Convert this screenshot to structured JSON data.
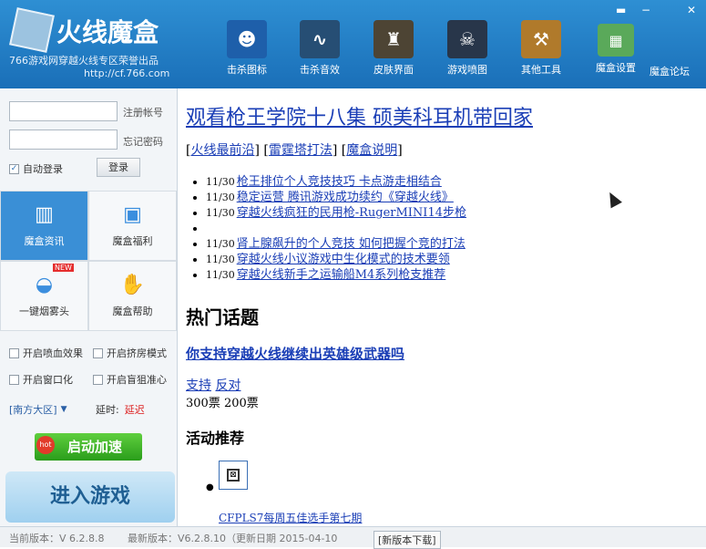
{
  "app": {
    "title": "火线魔盒",
    "subtitle": "766游戏网穿越火线专区荣誉出品",
    "url": "http://cf.766.com"
  },
  "toolbar": [
    {
      "label": "击杀图标",
      "icon": "kill-icon",
      "color": "#1e5faa"
    },
    {
      "label": "击杀音效",
      "icon": "sound-wave-icon",
      "color": "#264e74"
    },
    {
      "label": "皮肤界面",
      "icon": "skin-icon",
      "color": "#4d4434"
    },
    {
      "label": "游戏喷图",
      "icon": "spray-icon",
      "color": "#28364a"
    },
    {
      "label": "其他工具",
      "icon": "tools-icon",
      "color": "#b07a2b"
    }
  ],
  "header_links": {
    "settings": "魔盒设置",
    "forum": "魔盒论坛"
  },
  "window_controls": {
    "menu": "▬",
    "min": "−",
    "close": "✕"
  },
  "login": {
    "account_placeholder": "",
    "password_placeholder": "",
    "register_label": "注册帐号",
    "forgot_label": "忘记密码",
    "auto_login_label": "自动登录",
    "auto_login_checked": true,
    "login_button": "登录"
  },
  "nav_tiles": [
    {
      "label": "魔盒资讯",
      "icon": "book-icon",
      "active": true
    },
    {
      "label": "魔盒福利",
      "icon": "gift-icon",
      "active": false
    },
    {
      "label": "一键烟雾头",
      "icon": "helmet-icon",
      "active": false,
      "badge": "NEW"
    },
    {
      "label": "魔盒帮助",
      "icon": "hand-icon",
      "active": false
    }
  ],
  "options": [
    {
      "label": "开启喷血效果",
      "checked": false
    },
    {
      "label": "开启挤房模式",
      "checked": false
    },
    {
      "label": "开启窗口化",
      "checked": false
    },
    {
      "label": "开启盲狙准心",
      "checked": false
    }
  ],
  "server": {
    "region": "[南方大区]",
    "latency_label": "延时:",
    "latency_value": "延迟"
  },
  "accelerate_button": "启动加速",
  "hot_badge": "hot",
  "enter_game_button": "进入游戏",
  "content": {
    "headline": "观看枪王学院十八集 硕美科耳机带回家",
    "tabs": [
      "火线最前沿",
      "雷霆塔打法",
      "魔盒说明"
    ],
    "news": [
      {
        "date": "11/30",
        "title": "枪王排位个人竞技技巧 卡点游走相结合"
      },
      {
        "date": "11/30",
        "title": "稳定运营 腾讯游戏成功续约《穿越火线》"
      },
      {
        "date": "11/30",
        "title": "穿越火线疯狂的民用枪-RugerMINI14步枪"
      },
      {
        "date": "",
        "title": ""
      },
      {
        "date": "11/30",
        "title": "肾上腺飙升的个人竞技 如何把握个竞的打法"
      },
      {
        "date": "11/30",
        "title": "穿越火线小议游戏中生化模式的技术要领"
      },
      {
        "date": "11/30",
        "title": "穿越火线新手之运输船M4系列枪支推荐"
      }
    ],
    "hot_topics_title": "热门话题",
    "poll_question": "你支持穿越火线继续出英雄级武器吗",
    "poll_support": "支持",
    "poll_oppose": "反对",
    "poll_counts": "300票 200票",
    "activity_title": "活动推荐",
    "activity_item": "CFPLS7每周五佳选手第七期"
  },
  "statusbar": {
    "current_version": "当前版本：V 6.2.8.8",
    "latest_version": "最新版本：V6.2.8.10（更新日期 2015-04-10",
    "download_button": "[新版本下载]"
  }
}
